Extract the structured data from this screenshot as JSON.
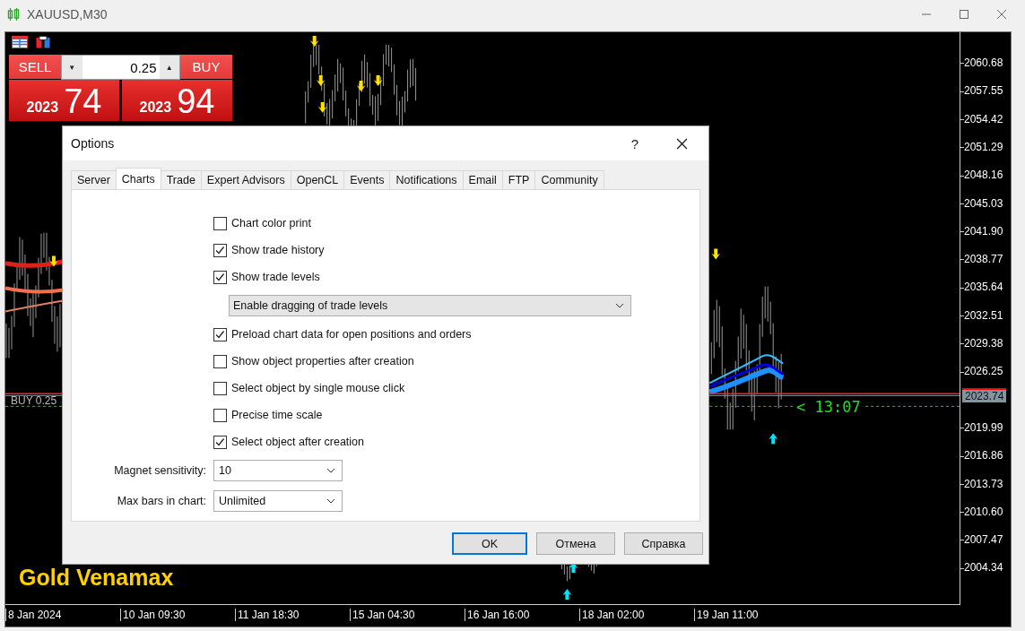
{
  "window": {
    "title": "XAUUSD,M30"
  },
  "trade_panel": {
    "sell_label": "SELL",
    "buy_label": "BUY",
    "volume": "0.25",
    "down_glyph": "▼",
    "up_glyph": "▲",
    "sell_price": {
      "base": "2023",
      "pips": "74"
    },
    "buy_price": {
      "base": "2023",
      "pips": "94"
    }
  },
  "chart": {
    "position_label": "BUY 0.25",
    "countdown": "< 13:07",
    "watermark": "Gold Venamax",
    "current_price": "2023.74",
    "price_axis": [
      "2060.68",
      "2057.55",
      "2054.42",
      "2051.29",
      "2048.16",
      "2045.03",
      "2041.90",
      "2038.77",
      "2035.64",
      "2032.51",
      "2029.38",
      "2026.25",
      "2019.99",
      "2016.86",
      "2013.73",
      "2010.60",
      "2007.47",
      "2004.34"
    ],
    "time_axis": [
      "8 Jan 2024",
      "10 Jan 09:30",
      "11 Jan 18:30",
      "15 Jan 04:30",
      "16 Jan 16:00",
      "18 Jan 02:00",
      "19 Jan 11:00"
    ]
  },
  "options_dialog": {
    "title": "Options",
    "help": "?",
    "tabs": [
      {
        "label": "Server",
        "selected": false
      },
      {
        "label": "Charts",
        "selected": true
      },
      {
        "label": "Trade",
        "selected": false
      },
      {
        "label": "Expert Advisors",
        "selected": false
      },
      {
        "label": "OpenCL",
        "selected": false
      },
      {
        "label": "Events",
        "selected": false
      },
      {
        "label": "Notifications",
        "selected": false
      },
      {
        "label": "Email",
        "selected": false
      },
      {
        "label": "FTP",
        "selected": false
      },
      {
        "label": "Community",
        "selected": false
      }
    ],
    "items": [
      {
        "kind": "checkbox",
        "label": "Chart color print",
        "checked": false
      },
      {
        "kind": "checkbox",
        "label": "Show trade history",
        "checked": true
      },
      {
        "kind": "checkbox",
        "label": "Show trade levels",
        "checked": true
      },
      {
        "kind": "dropdown",
        "value": "Enable dragging of trade levels"
      },
      {
        "kind": "checkbox",
        "label": "Preload chart data for open positions and orders",
        "checked": true
      },
      {
        "kind": "checkbox",
        "label": "Show object properties after creation",
        "checked": false
      },
      {
        "kind": "checkbox",
        "label": "Select object by single mouse click",
        "checked": false
      },
      {
        "kind": "checkbox",
        "label": "Precise time scale",
        "checked": false
      },
      {
        "kind": "checkbox",
        "label": "Select object after creation",
        "checked": true
      }
    ],
    "fields": [
      {
        "label": "Magnet sensitivity:",
        "value": "10"
      },
      {
        "label": "Max bars in chart:",
        "value": "Unlimited"
      }
    ],
    "buttons": [
      {
        "label": "OK",
        "default": true
      },
      {
        "label": "Отмена",
        "default": false
      },
      {
        "label": "Справка",
        "default": false
      }
    ]
  }
}
